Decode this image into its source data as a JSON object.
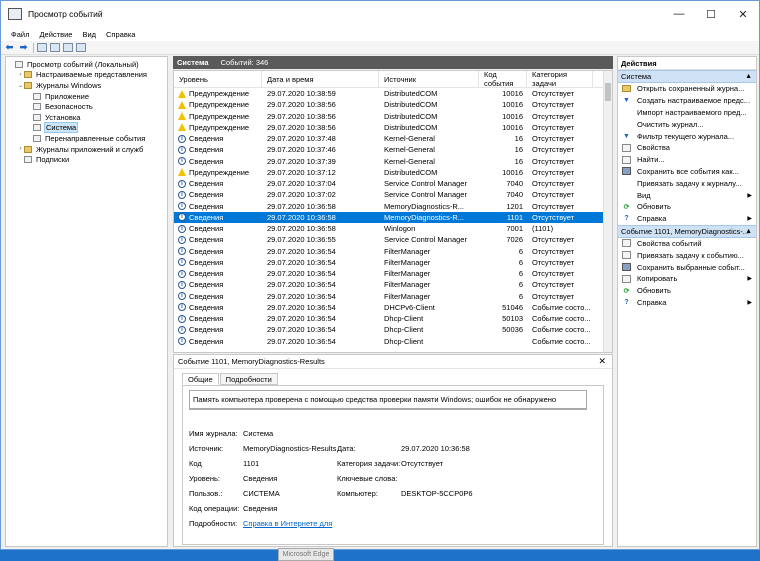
{
  "window": {
    "title": "Просмотр событий"
  },
  "menu": [
    "Файл",
    "Действие",
    "Вид",
    "Справка"
  ],
  "tree": [
    {
      "label": "Просмотр событий (Локальный)",
      "indent": 0,
      "exp": "",
      "icon": "box"
    },
    {
      "label": "Настраиваемые представления",
      "indent": 1,
      "exp": "›",
      "icon": "folder"
    },
    {
      "label": "Журналы Windows",
      "indent": 1,
      "exp": "⌄",
      "icon": "folder"
    },
    {
      "label": "Приложение",
      "indent": 2,
      "exp": "",
      "icon": "box"
    },
    {
      "label": "Безопасность",
      "indent": 2,
      "exp": "",
      "icon": "box"
    },
    {
      "label": "Установка",
      "indent": 2,
      "exp": "",
      "icon": "box"
    },
    {
      "label": "Система",
      "indent": 2,
      "exp": "",
      "icon": "box",
      "selected": true
    },
    {
      "label": "Перенаправленные события",
      "indent": 2,
      "exp": "",
      "icon": "box"
    },
    {
      "label": "Журналы приложений и служб",
      "indent": 1,
      "exp": "›",
      "icon": "folder"
    },
    {
      "label": "Подписки",
      "indent": 1,
      "exp": "",
      "icon": "box"
    }
  ],
  "center": {
    "log_name": "Система",
    "event_count": "Событий: 346"
  },
  "columns": [
    "Уровень",
    "Дата и время",
    "Источник",
    "Код события",
    "Категория задачи"
  ],
  "rows": [
    {
      "level": "Предупреждение",
      "type": "warn",
      "date": "29.07.2020 10:38:59",
      "source": "DistributedCOM",
      "id": "10016",
      "cat": "Отсутствует"
    },
    {
      "level": "Предупреждение",
      "type": "warn",
      "date": "29.07.2020 10:38:56",
      "source": "DistributedCOM",
      "id": "10016",
      "cat": "Отсутствует"
    },
    {
      "level": "Предупреждение",
      "type": "warn",
      "date": "29.07.2020 10:38:56",
      "source": "DistributedCOM",
      "id": "10016",
      "cat": "Отсутствует"
    },
    {
      "level": "Предупреждение",
      "type": "warn",
      "date": "29.07.2020 10:38:56",
      "source": "DistributedCOM",
      "id": "10016",
      "cat": "Отсутствует"
    },
    {
      "level": "Сведения",
      "type": "info",
      "date": "29.07.2020 10:37:48",
      "source": "Kernel-General",
      "id": "16",
      "cat": "Отсутствует"
    },
    {
      "level": "Сведения",
      "type": "info",
      "date": "29.07.2020 10:37:46",
      "source": "Kernel-General",
      "id": "16",
      "cat": "Отсутствует"
    },
    {
      "level": "Сведения",
      "type": "info",
      "date": "29.07.2020 10:37:39",
      "source": "Kernel-General",
      "id": "16",
      "cat": "Отсутствует"
    },
    {
      "level": "Предупреждение",
      "type": "warn",
      "date": "29.07.2020 10:37:12",
      "source": "DistributedCOM",
      "id": "10016",
      "cat": "Отсутствует"
    },
    {
      "level": "Сведения",
      "type": "info",
      "date": "29.07.2020 10:37:04",
      "source": "Service Control Manager",
      "id": "7040",
      "cat": "Отсутствует"
    },
    {
      "level": "Сведения",
      "type": "info",
      "date": "29.07.2020 10:37:02",
      "source": "Service Control Manager",
      "id": "7040",
      "cat": "Отсутствует"
    },
    {
      "level": "Сведения",
      "type": "info",
      "date": "29.07.2020 10:36:58",
      "source": "MemoryDiagnostics-R...",
      "id": "1201",
      "cat": "Отсутствует"
    },
    {
      "level": "Сведения",
      "type": "info",
      "date": "29.07.2020 10:36:58",
      "source": "MemoryDiagnostics-R...",
      "id": "1101",
      "cat": "Отсутствует",
      "selected": true
    },
    {
      "level": "Сведения",
      "type": "info",
      "date": "29.07.2020 10:36:58",
      "source": "Winlogon",
      "id": "7001",
      "cat": "(1101)"
    },
    {
      "level": "Сведения",
      "type": "info",
      "date": "29.07.2020 10:36:55",
      "source": "Service Control Manager",
      "id": "7026",
      "cat": "Отсутствует"
    },
    {
      "level": "Сведения",
      "type": "info",
      "date": "29.07.2020 10:36:54",
      "source": "FilterManager",
      "id": "6",
      "cat": "Отсутствует"
    },
    {
      "level": "Сведения",
      "type": "info",
      "date": "29.07.2020 10:36:54",
      "source": "FilterManager",
      "id": "6",
      "cat": "Отсутствует"
    },
    {
      "level": "Сведения",
      "type": "info",
      "date": "29.07.2020 10:36:54",
      "source": "FilterManager",
      "id": "6",
      "cat": "Отсутствует"
    },
    {
      "level": "Сведения",
      "type": "info",
      "date": "29.07.2020 10:36:54",
      "source": "FilterManager",
      "id": "6",
      "cat": "Отсутствует"
    },
    {
      "level": "Сведения",
      "type": "info",
      "date": "29.07.2020 10:36:54",
      "source": "FilterManager",
      "id": "6",
      "cat": "Отсутствует"
    },
    {
      "level": "Сведения",
      "type": "info",
      "date": "29.07.2020 10:36:54",
      "source": "DHCPv6-Client",
      "id": "51046",
      "cat": "Событие состо..."
    },
    {
      "level": "Сведения",
      "type": "info",
      "date": "29.07.2020 10:36:54",
      "source": "Dhcp-Client",
      "id": "50103",
      "cat": "Событие состо..."
    },
    {
      "level": "Сведения",
      "type": "info",
      "date": "29.07.2020 10:36:54",
      "source": "Dhcp-Client",
      "id": "50036",
      "cat": "Событие состо..."
    },
    {
      "level": "Сведения",
      "type": "info",
      "date": "29.07.2020 10:36:54",
      "source": "Dhcp-Client",
      "id": "",
      "cat": "Событие состо..."
    }
  ],
  "details": {
    "header": "Событие 1101, MemoryDiagnostics-Results",
    "tabs": [
      "Общие",
      "Подробности"
    ],
    "description": "Память компьютера проверена с помощью средства проверки памяти Windows; ошибок не обнаружено",
    "labels": {
      "log": "Имя журнала:",
      "source": "Источник:",
      "code": "Код",
      "level": "Уровень:",
      "user": "Пользов.:",
      "opcode": "Код операции:",
      "more": "Подробности:",
      "date": "Дата:",
      "task": "Категория задачи:",
      "keywords": "Ключевые слова:",
      "computer": "Компьютер:"
    },
    "values": {
      "log": "Система",
      "source": "MemoryDiagnostics-Results",
      "code": "1101",
      "level": "Сведения",
      "user": "СИСТЕМА",
      "opcode": "Сведения",
      "more": "Справка в Интернете для",
      "date": "29.07.2020 10:36:58",
      "task": "Отсутствует",
      "keywords": "",
      "computer": "DESKTOP-5CCP0P6"
    }
  },
  "actions": {
    "title": "Действия",
    "section1": "Система",
    "items1": [
      {
        "label": "Открыть сохраненный журна...",
        "icon": "folder"
      },
      {
        "label": "Создать настраиваемое предс...",
        "icon": "filter"
      },
      {
        "label": "Импорт настраиваемого пред...",
        "icon": "none"
      },
      {
        "label": "Очистить журнал...",
        "icon": "none"
      },
      {
        "label": "Фильтр текущего журнала...",
        "icon": "filter"
      },
      {
        "label": "Свойства",
        "icon": "doc"
      },
      {
        "label": "Найти...",
        "icon": "doc"
      },
      {
        "label": "Сохранить все события как...",
        "icon": "save"
      },
      {
        "label": "Привязать задачу к журналу...",
        "icon": "none"
      },
      {
        "label": "Вид",
        "icon": "none",
        "submenu": true
      },
      {
        "label": "Обновить",
        "icon": "refresh"
      },
      {
        "label": "Справка",
        "icon": "help",
        "submenu": true
      }
    ],
    "section2": "Событие 1101, MemoryDiagnostics-...",
    "items2": [
      {
        "label": "Свойства событий",
        "icon": "doc"
      },
      {
        "label": "Привязать задачу к событию...",
        "icon": "doc"
      },
      {
        "label": "Сохранить выбранные событ...",
        "icon": "save"
      },
      {
        "label": "Копировать",
        "icon": "doc",
        "submenu": true
      },
      {
        "label": "Обновить",
        "icon": "refresh"
      },
      {
        "label": "Справка",
        "icon": "help",
        "submenu": true
      }
    ]
  },
  "taskbar_tooltip": "Microsoft Edge"
}
